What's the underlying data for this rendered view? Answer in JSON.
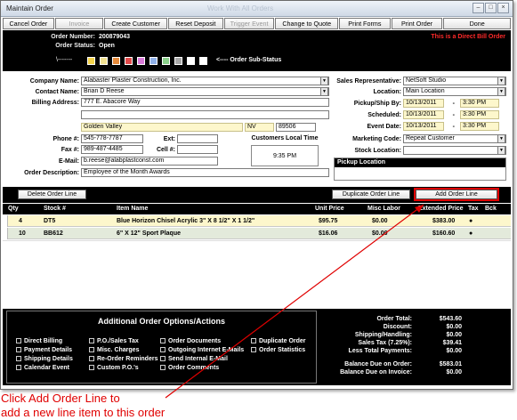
{
  "window": {
    "title": "Maintain Order",
    "ghost_title": "Work With All Orders"
  },
  "toolbar": [
    "Cancel Order",
    "Invoice",
    "Create Customer",
    "Reset Deposit",
    "Trigger Event",
    "Change to Quote",
    "Print Forms",
    "Print Order",
    "Done"
  ],
  "header": {
    "order_number_label": "Order Number:",
    "order_number": "200879043",
    "order_status_label": "Order Status:",
    "order_status": "Open",
    "direct_bill_text": "This is a Direct Bill Order",
    "backslash": "\\-------",
    "sub_status_label": "<---- Order Sub-Status",
    "status_colors": [
      "#f2d24a",
      "#f0e090",
      "#e68a3a",
      "#e24a4a",
      "#d87ad8",
      "#8fb0e8",
      "#8ad08a",
      "#a8a8a8",
      "#ffffff",
      "#ffffff"
    ]
  },
  "form": {
    "company_label": "Company Name:",
    "company": "Alabaster Plaster Construction, Inc.",
    "contact_label": "Contact Name:",
    "contact": "Brian D Reese",
    "billing_label": "Billing Address:",
    "billing1": "777 E. Abacore Way",
    "billing2": "",
    "city": "Golden Valley",
    "state": "NV",
    "zip": "89506",
    "phone_label": "Phone #:",
    "phone": "545-778-7787",
    "ext_label": "Ext:",
    "fax_label": "Fax #:",
    "fax": "989-487-4485",
    "cell_label": "Cell #:",
    "email_label": "E-Mail:",
    "email": "b.reese@alabplastconst.com",
    "desc_label": "Order Description:",
    "desc": "Employee of the Month Awards",
    "local_time_label": "Customers Local Time",
    "local_time": "9:35 PM",
    "sales_rep_label": "Sales Representative:",
    "sales_rep": "NetSoft Studio",
    "location_label": "Location:",
    "location": "Main Location",
    "pickup_label": "Pickup/Ship By:",
    "pickup_date": "10/13/2011",
    "pickup_time": "3:30 PM",
    "scheduled_label": "Scheduled:",
    "scheduled_date": "10/13/2011",
    "scheduled_time": "3:30 PM",
    "event_label": "Event Date:",
    "event_date": "10/13/2011",
    "event_time": "3:30 PM",
    "marketing_label": "Marketing Code:",
    "marketing": "Repeat Customer",
    "stock_label": "Stock Location:",
    "stock": "",
    "pickup_location_label": "Pickup Location",
    "dash": "-"
  },
  "lines": {
    "delete_btn": "Delete Order Line",
    "duplicate_btn": "Duplicate Order Line",
    "add_btn": "Add Order Line",
    "headers": [
      "Qty",
      "Stock #",
      "Item Name",
      "Unit Price",
      "Misc Labor",
      "Extended Price",
      "Tax",
      "Bck"
    ],
    "rows": [
      {
        "qty": "4",
        "stock": "DT5",
        "item": "Blue Horizon Chisel Acrylic 3\" X 8 1/2\" X 1 1/2\"",
        "unit": "$95.75",
        "misc": "$0.00",
        "ext": "$383.00",
        "tax": "●"
      },
      {
        "qty": "10",
        "stock": "BB612",
        "item": "6\" X 12\" Sport Plaque",
        "unit": "$16.06",
        "misc": "$0.00",
        "ext": "$160.60",
        "tax": "●"
      }
    ]
  },
  "options": {
    "title": "Additional Order Options/Actions",
    "col1": [
      "Direct Billing",
      "Payment Details",
      "Shipping Details",
      "Calendar Event"
    ],
    "col2": [
      "P.O./Sales Tax",
      "Misc. Charges",
      "Re-Order Reminders",
      "Custom P.O.'s"
    ],
    "col3": [
      "Order Documents",
      "Outgoing Internet E-Mails",
      "Send Internal E-Mail",
      "Order Comments"
    ],
    "col4": [
      "Duplicate Order",
      "Order Statistics"
    ]
  },
  "totals": [
    {
      "label": "Order Total:",
      "value": "$543.60"
    },
    {
      "label": "Discount:",
      "value": "$0.00"
    },
    {
      "label": "Shipping/Handling:",
      "value": "$0.00"
    },
    {
      "label": "Sales Tax (7.25%):",
      "value": "$39.41"
    },
    {
      "label": "Less Total Payments:",
      "value": "$0.00"
    },
    {
      "label": "Balance Due on Order:",
      "value": "$583.01"
    },
    {
      "label": "Balance Due on Invoice:",
      "value": "$0.00"
    }
  ],
  "callout": {
    "line1": "Click Add Order Line to",
    "line2": "add a new line item to this order"
  }
}
